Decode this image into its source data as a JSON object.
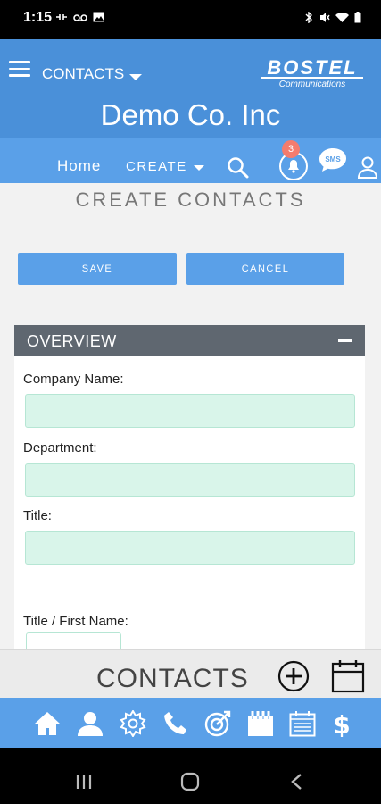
{
  "status_bar": {
    "time": "1:15",
    "left_icons": [
      "vpn-icon",
      "voicemail-icon",
      "gallery-icon"
    ],
    "right_icons": [
      "bluetooth-icon",
      "mute-icon",
      "wifi-icon",
      "battery-icon"
    ]
  },
  "header": {
    "module": "CONTACTS",
    "logo_text": "BOSTEL",
    "logo_subtext": "Communications",
    "company_name": "Demo Co. Inc"
  },
  "nav": {
    "home_label": "Home",
    "create_label": "CREATE",
    "notification_count": "3",
    "sms_label": "SMS"
  },
  "page": {
    "title": "CREATE CONTACTS",
    "save_label": "SAVE",
    "cancel_label": "CANCEL"
  },
  "overview": {
    "title": "OVERVIEW",
    "fields": {
      "company_name": {
        "label": "Company Name:",
        "value": ""
      },
      "department": {
        "label": "Department:",
        "value": ""
      },
      "title": {
        "label": "Title:",
        "value": ""
      },
      "first_name": {
        "label": "Title / First Name:",
        "value": ""
      }
    }
  },
  "quick_bar": {
    "title": "CONTACTS"
  },
  "bottom_nav": [
    "home-icon",
    "contact-icon",
    "settings-icon",
    "phone-icon",
    "target-icon",
    "calendar-icon",
    "notes-icon",
    "billing-icon"
  ],
  "colors": {
    "header_blue": "#4a90d9",
    "nav_blue": "#5aa0e8",
    "section_header": "#5f6770",
    "field_fill": "#d9f5ea",
    "badge": "#f47c6e"
  }
}
